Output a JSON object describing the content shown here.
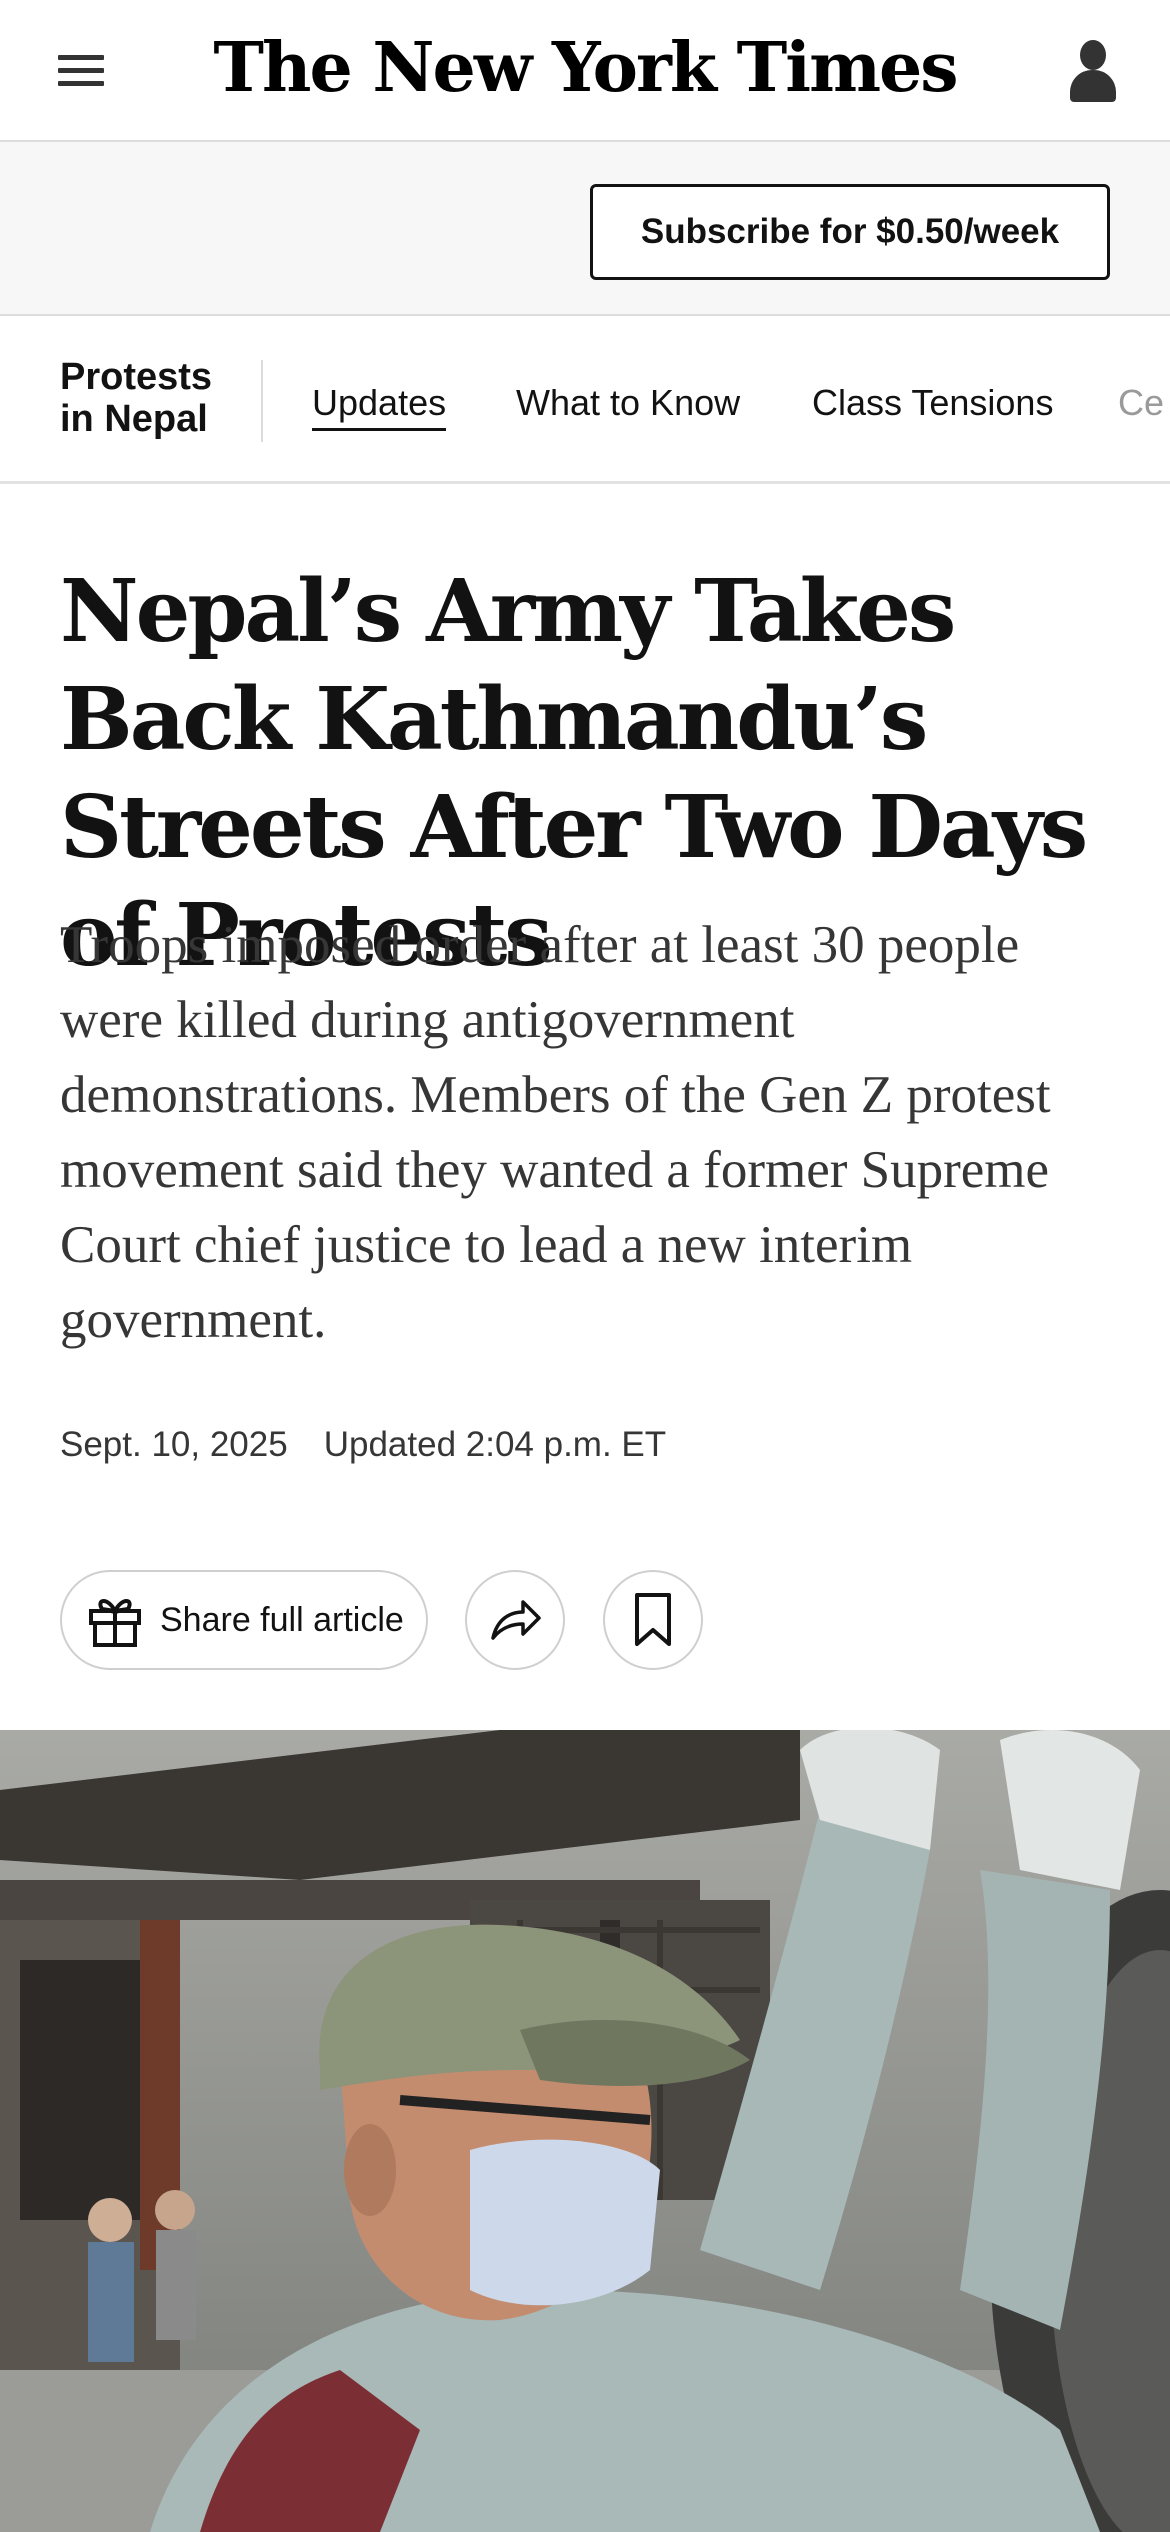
{
  "header": {
    "logo_text": "The New York Times",
    "menu_icon": "hamburger-menu-icon",
    "account_icon": "account-icon"
  },
  "subscribe": {
    "label": "Subscribe for $0.50/week"
  },
  "topic_nav": {
    "label_line1": "Protests",
    "label_line2": "in Nepal",
    "tabs": [
      {
        "label": "Updates",
        "active": true
      },
      {
        "label": "What to Know",
        "active": false
      },
      {
        "label": "Class Tensions",
        "active": false
      },
      {
        "label": "Ce",
        "active": false
      }
    ]
  },
  "article": {
    "headline": "Nepal’s Army Takes Back Kathmandu’s Streets After Two Days of Protests",
    "summary": "Troops imposed order after at least 30 people were killed during antigovernment demonstrations. Members of the Gen Z protest movement said they wanted a former Supreme Court chief justice to lead a new interim government.",
    "date": "Sept. 10, 2025",
    "updated": "Updated 2:04 p.m. ET"
  },
  "actions": {
    "share_label": "Share full article",
    "share_icon": "gift-icon",
    "forward_icon": "share-arrow-icon",
    "bookmark_icon": "bookmark-icon"
  },
  "lead_image": {
    "subject": "masked-man-in-cap-on-kathmandu-street"
  }
}
